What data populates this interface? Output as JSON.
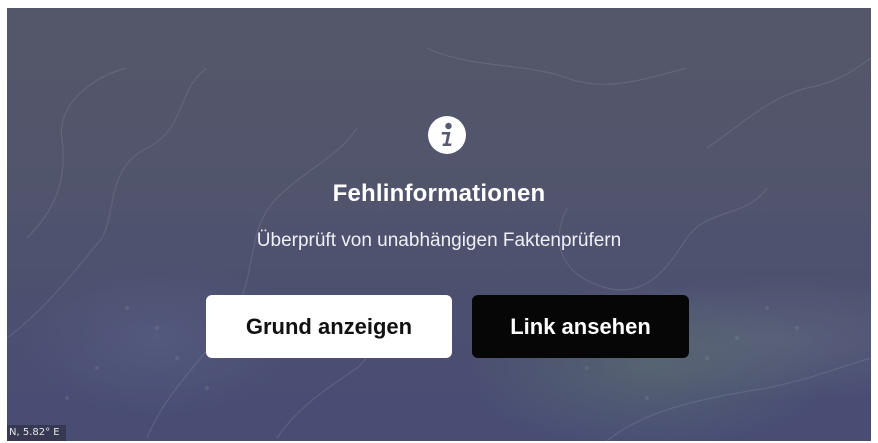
{
  "overlay": {
    "icon": "info-icon",
    "title": "Fehlinformationen",
    "subtitle": "Überprüft von unabhängigen Faktenprüfern",
    "buttons": {
      "reason_label": "Grund anzeigen",
      "link_label": "Link ansehen"
    }
  },
  "map": {
    "coordinate_text": "N, 5.82° E"
  },
  "colors": {
    "overlay_tint": "#575a73",
    "primary_button_bg": "#ffffff",
    "secondary_button_bg": "#060606",
    "text_light": "#ffffff"
  }
}
